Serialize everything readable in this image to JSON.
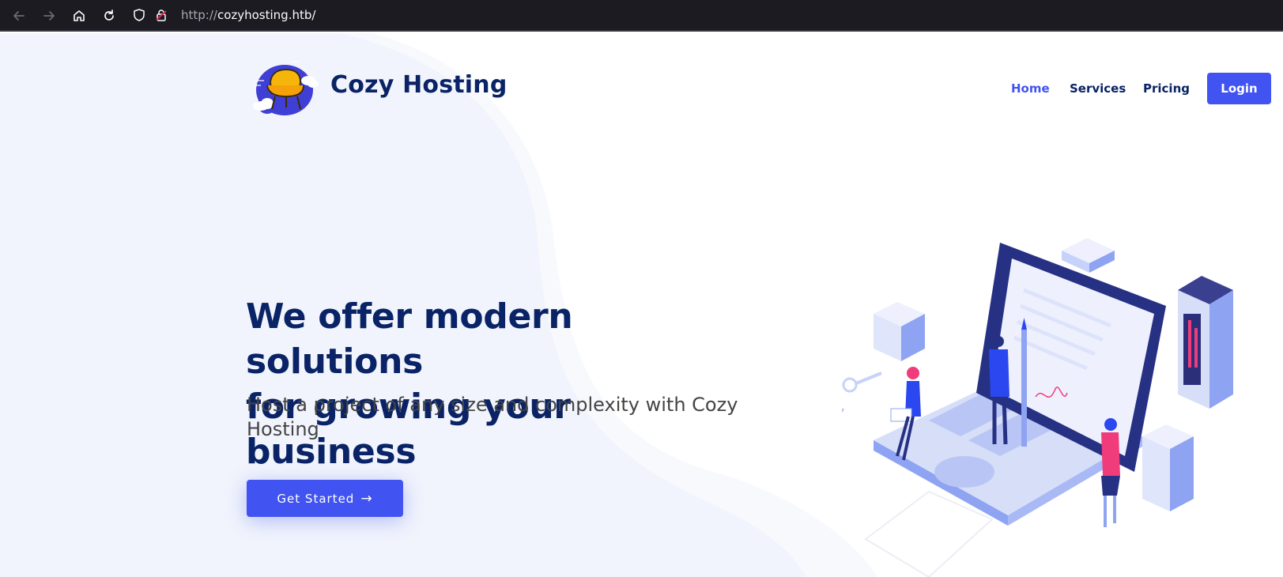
{
  "browser": {
    "url_scheme": "http://",
    "url_host": "cozyhosting.htb/",
    "icons": [
      "back-icon",
      "forward-icon",
      "home-icon",
      "reload-icon",
      "shield-icon",
      "lock-icon"
    ]
  },
  "header": {
    "brand": "Cozy Hosting",
    "nav": {
      "home": "Home",
      "services": "Services",
      "pricing": "Pricing",
      "login": "Login"
    }
  },
  "hero": {
    "title_line1": "We offer modern solutions",
    "title_line2": "for growing your business",
    "subtitle": "Host a project of any size and complexity with Cozy Hosting",
    "cta_label": "Get Started"
  },
  "colors": {
    "accent": "#4154f1",
    "heading": "#0a2366",
    "body_text": "#444444",
    "hero_bg": "#f1f4fc",
    "chrome_bg": "#1c1b22"
  }
}
